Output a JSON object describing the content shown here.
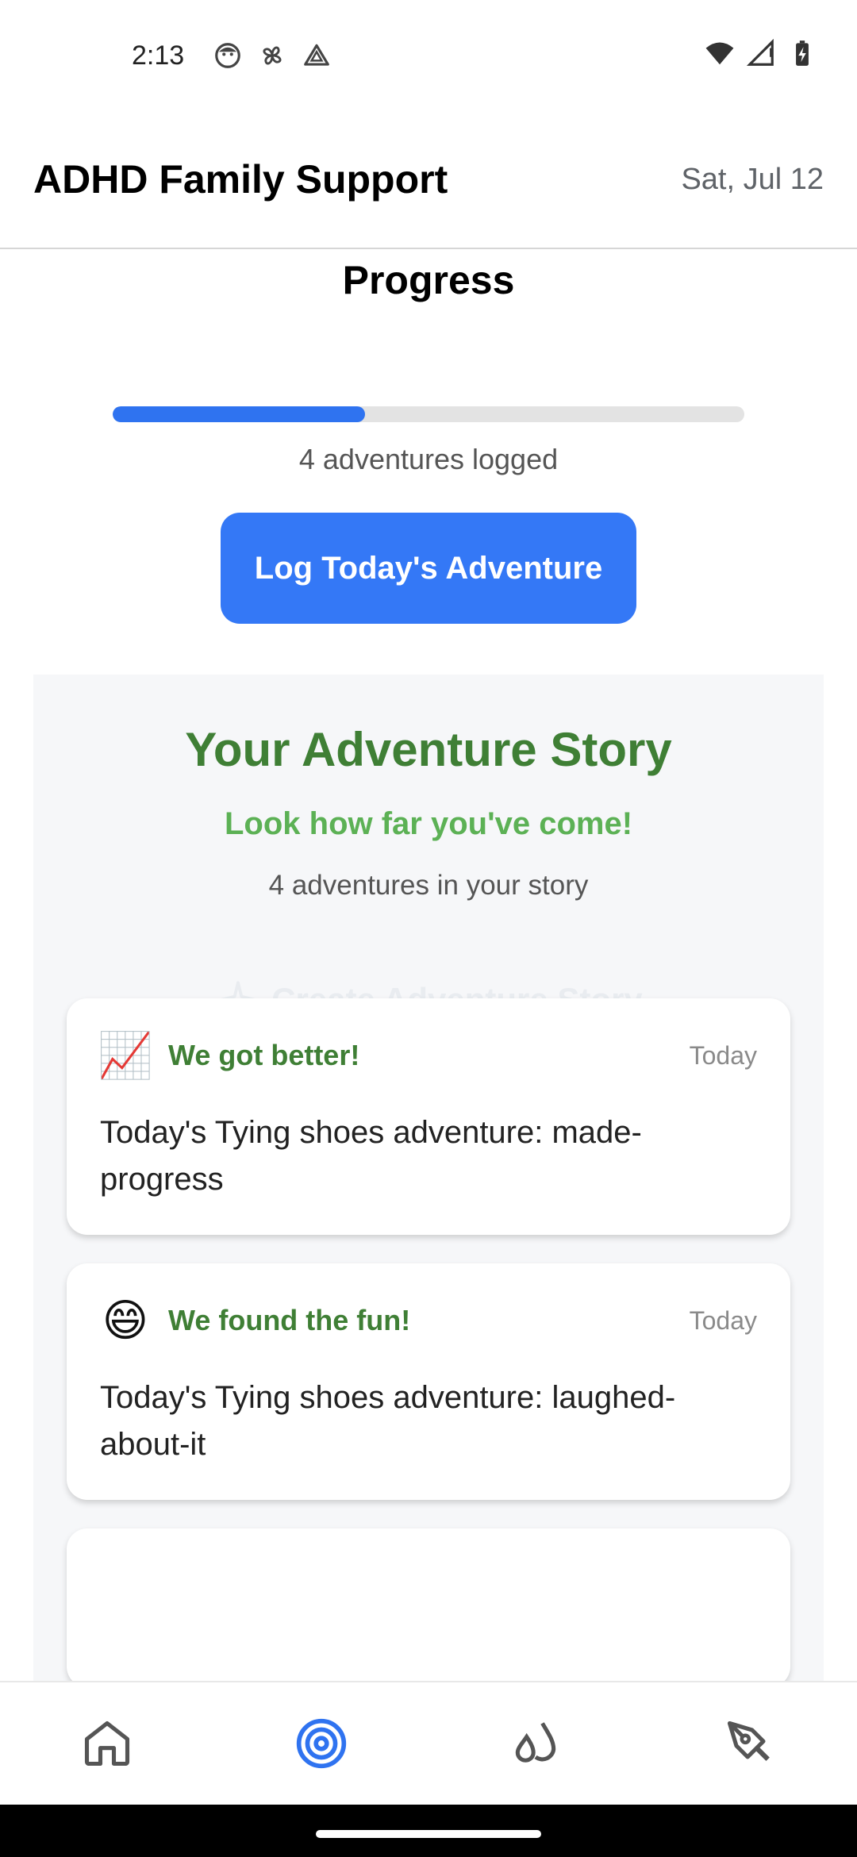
{
  "status_bar": {
    "time": "2:13",
    "left_icons": [
      "face-icon",
      "pinwheel-icon",
      "triangle-alert-icon"
    ],
    "right_icons": [
      "wifi-icon",
      "signal-icon",
      "battery-charging-icon"
    ]
  },
  "header": {
    "title": "ADHD Family Support",
    "date": "Sat, Jul 12"
  },
  "progress": {
    "title": "Progress",
    "fraction": 0.4,
    "caption": "4 adventures logged",
    "button_label": "Log Today's Adventure"
  },
  "story": {
    "title": "Your Adventure Story",
    "subtitle": "Look how far you've come!",
    "count": "4 adventures in your story",
    "create_label": "Create Adventure Story",
    "entries": [
      {
        "emoji": "📈",
        "label": "We got better!",
        "time": "Today",
        "text": "Today's Tying shoes adventure: made-progress"
      },
      {
        "emoji": "😄",
        "label": "We found the fun!",
        "time": "Today",
        "text": "Today's Tying shoes adventure: laughed-about-it"
      }
    ]
  },
  "colors": {
    "accent": "#3478f6",
    "story_green": "#3f7f35",
    "story_light_green": "#5cb155",
    "active_nav": "#2f73f0"
  },
  "nav": {
    "items": [
      {
        "icon": "home-icon",
        "active": false
      },
      {
        "icon": "target-icon",
        "active": true
      },
      {
        "icon": "drops-icon",
        "active": false
      },
      {
        "icon": "pen-icon",
        "active": false
      }
    ]
  }
}
